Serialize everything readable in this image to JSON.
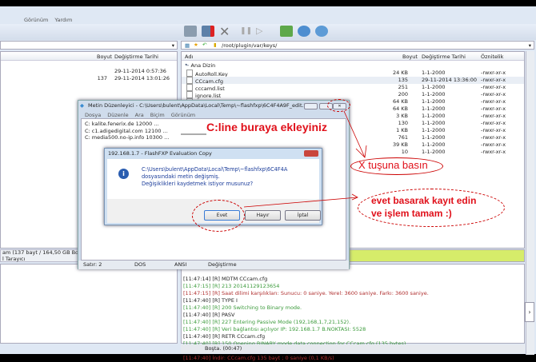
{
  "menu": [
    "Görünüm",
    "Yardım"
  ],
  "right_path": "/root/plugin/var/keys/",
  "left_columns": {
    "size": "Boyut",
    "date": "Değiştirme Tarihi"
  },
  "left_rows": [
    {
      "size": "",
      "date": "29-11-2014 0:57:36"
    },
    {
      "size": "137",
      "date": "29-11-2014 13:01:26"
    }
  ],
  "right_columns": {
    "name": "Adı",
    "size": "Boyut",
    "date": "Değiştirme Tarihi",
    "attr": "Öznitelik"
  },
  "parent_dir": "Ana Dizin",
  "right_rows": [
    {
      "name": "AutoRoll.Key",
      "size": "24 KB",
      "date": "1-1-2000",
      "attr": "-rwxr-xr-x"
    },
    {
      "name": "CCcam.cfg",
      "size": "135",
      "date": "29-11-2014 13:36:00",
      "attr": "-rwxr-xr-x"
    },
    {
      "name": "cccamd.list",
      "size": "251",
      "date": "1-1-2000",
      "attr": "-rwxr-xr-x"
    },
    {
      "name": "ignore.list",
      "size": "200",
      "date": "1-1-2000",
      "attr": "-rwxr-xr-x"
    },
    {
      "name": "",
      "size": "64 KB",
      "date": "1-1-2000",
      "attr": "-rwxr-xr-x"
    },
    {
      "name": "",
      "size": "64 KB",
      "date": "1-1-2000",
      "attr": "-rwxr-xr-x"
    },
    {
      "name": "",
      "size": "3 KB",
      "date": "1-1-2000",
      "attr": "-rwxr-xr-x"
    },
    {
      "name": "",
      "size": "130",
      "date": "1-1-2000",
      "attr": "-rwxr-xr-x"
    },
    {
      "name": "",
      "size": "1 KB",
      "date": "1-1-2000",
      "attr": "-rwxr-xr-x"
    },
    {
      "name": "",
      "size": "761",
      "date": "1-1-2000",
      "attr": "-rwxr-xr-x"
    },
    {
      "name": "",
      "size": "39 KB",
      "date": "1-1-2000",
      "attr": "-rwxr-xr-x"
    },
    {
      "name": "",
      "size": "10",
      "date": "1-1-2000",
      "attr": "-rwxr-xr-x"
    }
  ],
  "left_status": [
    "am (137 bayt / 164,50 GB Boş)",
    "l Tarayıcı"
  ],
  "right_status": [
    "Toplam, 1 Seçili (135 bayt)",
    "168.1.7"
  ],
  "log": [
    {
      "t": "[11:47:14] [R] MDTM CCcam.cfg",
      "c": "blk"
    },
    {
      "t": "[11:47:15] [R] 213 20141129123654",
      "c": "grn"
    },
    {
      "t": "[11:47:15] [R] Saat dilimi karşılıkları: Sunucu: 0 saniye. Yerel: 3600 saniye. Farkı: 3600 saniye.",
      "c": "red"
    },
    {
      "t": "[11:47:40] [R] TYPE I",
      "c": "blk"
    },
    {
      "t": "[11:47:40] [R] 200 Switching to Binary mode.",
      "c": "grn"
    },
    {
      "t": "[11:47:40] [R] PASV",
      "c": "blk"
    },
    {
      "t": "[11:47:40] [R] 227 Entering Passive Mode (192,168,1,7,21,152).",
      "c": "grn"
    },
    {
      "t": "[11:47:40] [R] Veri bağlantısı açılıyor IP: 192.168.1.7 B.NOKTASI: 5528",
      "c": "grn"
    },
    {
      "t": "[11:47:40] [R] RETR CCcam.cfg",
      "c": "blk"
    },
    {
      "t": "[11:47:40] [R] 150 Opening BINARY mode data connection for CCcam.cfg (135 bytes).",
      "c": "grn"
    },
    {
      "t": "[11:47:40] [R] 226 File send OK.",
      "c": "grn"
    },
    {
      "t": "[11:47:40] İndir: CCcam.cfg 135 bayt ; 0 saniye (0,1 KB/s)",
      "c": "red"
    }
  ],
  "bottom_status": "Boşta. (00:47)",
  "editor": {
    "title": "Metin Düzenleyici - C:\\Users\\bulent\\AppData\\Local\\Temp\\~flashfxp\\6C4F4A9F_edit.t...",
    "menu": [
      "Dosya",
      "Düzenle",
      "Ara",
      "Biçim",
      "Görünüm"
    ],
    "lines": [
      "C: kalite.fenerix.de 12000 ...",
      "C: c1.adigedigital.com 12100 ...",
      "C: media500.no-ip.info 10300 ..."
    ],
    "status": [
      "Satır: 2",
      "DOS",
      "ANSI",
      "Değiştirme"
    ]
  },
  "dialog": {
    "title": "192.168.1.7 - FlashFXP Evaluation Copy",
    "message": [
      "C:\\Users\\bulent\\AppData\\Local\\Temp\\~flashfxp\\6C4F4A",
      "dosyasındaki metin değişmiş.",
      "Değişiklikleri kaydetmek istiyor musunuz?"
    ],
    "yes": "Evet",
    "no": "Hayır",
    "cancel": "İptal"
  },
  "annotations": {
    "cline": "C:line buraya ekleyiniz",
    "xbtn": "X tuşuna basın",
    "evet": [
      "evet basarak kayıt edin",
      "ve işlem tamam :)"
    ]
  }
}
